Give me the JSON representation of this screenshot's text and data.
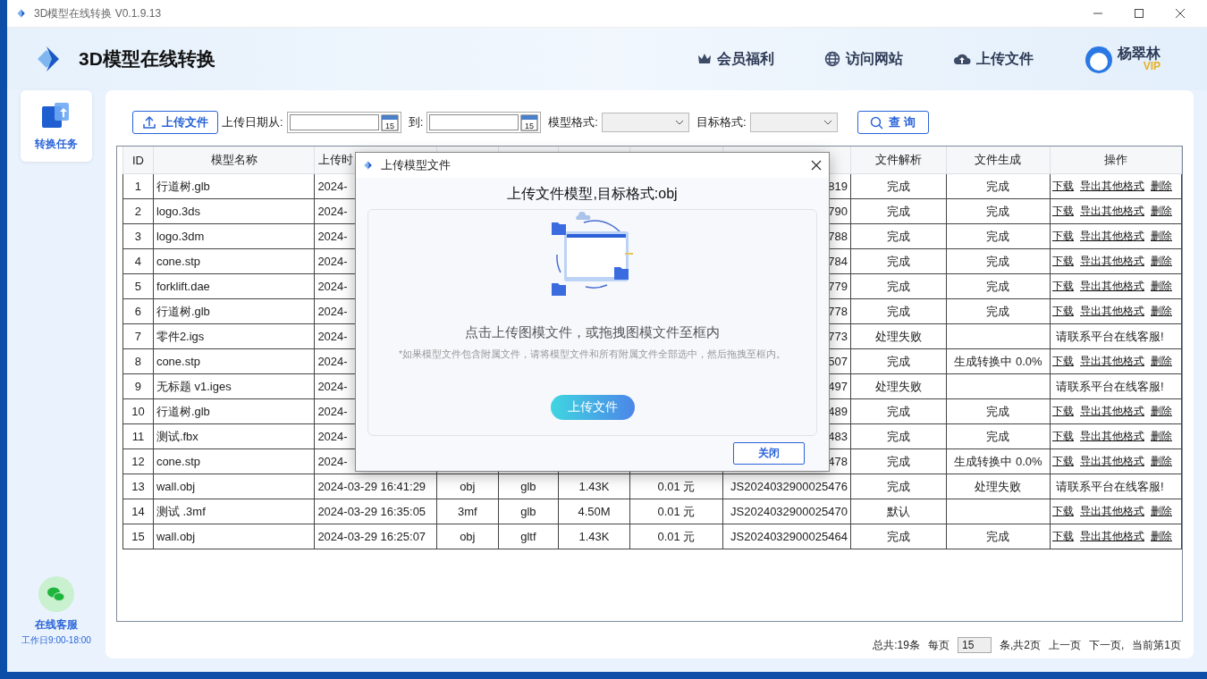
{
  "window": {
    "title": "3D模型在线转换 V0.1.9.13"
  },
  "header": {
    "app_name": "3D模型在线转换",
    "nav": [
      {
        "label": "会员福利",
        "kind": "crown"
      },
      {
        "label": "访问网站",
        "kind": "globe"
      },
      {
        "label": "上传文件",
        "kind": "upload"
      }
    ],
    "user": {
      "name": "杨翠林",
      "badge": "VIP"
    }
  },
  "sidebar": {
    "items": [
      {
        "label": "转换任务",
        "selected": true
      }
    ],
    "support": {
      "label": "在线客服",
      "hours": "工作日9:00-18:00"
    }
  },
  "filters": {
    "upload_button": "上传文件",
    "date_from_label": "上传日期从:",
    "date_from": {
      "icon_text": "15"
    },
    "date_to_label": "到:",
    "date_to": {
      "icon_text": "15"
    },
    "model_format_label": "模型格式:",
    "target_format_label": "目标格式:",
    "query_button": "查 询"
  },
  "table": {
    "header": {
      "id": "ID",
      "name": "模型名称",
      "uploaded": "上传时",
      "parse_status": "文件解析",
      "generate_status": "文件生成",
      "actions": "操作"
    },
    "rows": [
      {
        "id": "1",
        "name": "行道树.glb",
        "uploaded": "2024-",
        "order_no": "819",
        "parse_status": "完成",
        "generate_status": "完成",
        "actions": [
          "下载",
          "导出其他格式",
          "删除"
        ]
      },
      {
        "id": "2",
        "name": "logo.3ds",
        "uploaded": "2024-",
        "order_no": "790",
        "parse_status": "完成",
        "generate_status": "完成",
        "actions": [
          "下载",
          "导出其他格式",
          "删除"
        ]
      },
      {
        "id": "3",
        "name": "logo.3dm",
        "uploaded": "2024-",
        "order_no": "788",
        "parse_status": "完成",
        "generate_status": "完成",
        "actions": [
          "下载",
          "导出其他格式",
          "删除"
        ]
      },
      {
        "id": "4",
        "name": "cone.stp",
        "uploaded": "2024-",
        "order_no": "784",
        "parse_status": "完成",
        "generate_status": "完成",
        "actions": [
          "下载",
          "导出其他格式",
          "删除"
        ]
      },
      {
        "id": "5",
        "name": "forklift.dae",
        "uploaded": "2024-",
        "order_no": "779",
        "parse_status": "完成",
        "generate_status": "完成",
        "actions": [
          "下载",
          "导出其他格式",
          "删除"
        ]
      },
      {
        "id": "6",
        "name": "行道树.glb",
        "uploaded": "2024-",
        "order_no": "778",
        "parse_status": "完成",
        "generate_status": "完成",
        "actions": [
          "下载",
          "导出其他格式",
          "删除"
        ]
      },
      {
        "id": "7",
        "name": "零件2.igs",
        "uploaded": "2024-",
        "order_no": "773",
        "parse_status": "处理失败",
        "note": "请联系平台在线客服!"
      },
      {
        "id": "8",
        "name": "cone.stp",
        "uploaded": "2024-",
        "order_no": "507",
        "parse_status": "完成",
        "generate_status": "生成转换中 0.0%",
        "actions": [
          "下载",
          "导出其他格式",
          "删除"
        ]
      },
      {
        "id": "9",
        "name": "无标题 v1.iges",
        "uploaded": "2024-",
        "order_no": "497",
        "parse_status": "处理失败",
        "note": "请联系平台在线客服!"
      },
      {
        "id": "10",
        "name": "行道树.glb",
        "uploaded": "2024-",
        "order_no": "489",
        "parse_status": "完成",
        "generate_status": "完成",
        "actions": [
          "下载",
          "导出其他格式",
          "删除"
        ]
      },
      {
        "id": "11",
        "name": "测试.fbx",
        "uploaded": "2024-",
        "order_no": "483",
        "parse_status": "完成",
        "generate_status": "完成",
        "actions": [
          "下载",
          "导出其他格式",
          "删除"
        ]
      },
      {
        "id": "12",
        "name": "cone.stp",
        "uploaded": "2024-",
        "order_no": "478",
        "parse_status": "完成",
        "generate_status": "生成转换中 0.0%",
        "actions": [
          "下载",
          "导出其他格式",
          "删除"
        ]
      },
      {
        "id": "13",
        "name": "wall.obj",
        "uploaded": "2024-03-29 16:41:29",
        "source_format": "obj",
        "target_format": "glb",
        "size": "1.43K",
        "price": "0.01 元",
        "order_no": "JS2024032900025476",
        "parse_status": "完成",
        "generate_status": "处理失败",
        "note": "请联系平台在线客服!"
      },
      {
        "id": "14",
        "name": "测试 .3mf",
        "uploaded": "2024-03-29 16:35:05",
        "source_format": "3mf",
        "target_format": "glb",
        "size": "4.50M",
        "price": "0.01 元",
        "order_no": "JS2024032900025470",
        "parse_status": "默认",
        "actions": [
          "下载",
          "导出其他格式",
          "删除"
        ]
      },
      {
        "id": "15",
        "name": "wall.obj",
        "uploaded": "2024-03-29 16:25:07",
        "source_format": "obj",
        "target_format": "gltf",
        "size": "1.43K",
        "price": "0.01 元",
        "order_no": "JS2024032900025464",
        "parse_status": "完成",
        "generate_status": "完成",
        "actions": [
          "下载",
          "导出其他格式",
          "删除"
        ]
      }
    ]
  },
  "pagination": {
    "total": "总共:19条",
    "per_page_label": "每页",
    "per_page": "15",
    "pages": "条,共2页",
    "prev": "上一页",
    "next": "下一页,",
    "current": "当前第1页"
  },
  "dialog": {
    "title": "上传模型文件",
    "heading": "上传文件模型,目标格式:obj",
    "prompt": "点击上传图模文件，或拖拽图模文件至框内",
    "note": "*如果模型文件包含附属文件，请将模型文件和所有附属文件全部选中，然后拖拽至框内。",
    "upload_button": "上传文件",
    "close_button": "关闭"
  }
}
